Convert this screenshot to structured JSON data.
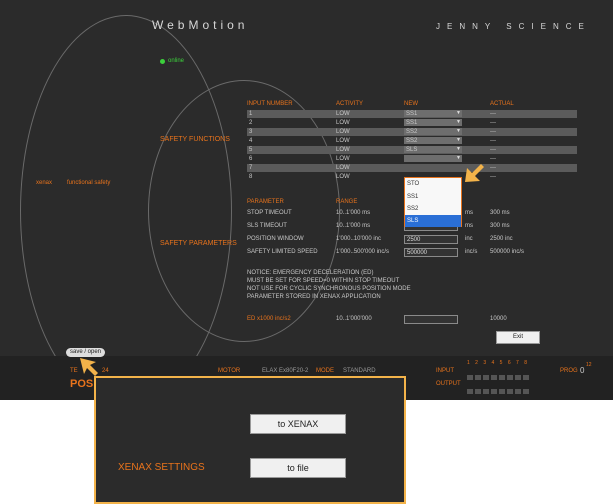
{
  "app": {
    "logo": "WebMotion",
    "brand": "JENNY SCIENCE",
    "status": "online",
    "nav_primary": "xenax",
    "nav_secondary": "functional safety"
  },
  "safety_functions": {
    "title": "SAFETY FUNCTIONS",
    "headers": [
      "INPUT NUMBER",
      "ACTIVITY",
      "NEW",
      "ACTUAL"
    ],
    "rows": [
      {
        "num": "1",
        "activity": "LOW",
        "new": "SS1",
        "actual": "---"
      },
      {
        "num": "2",
        "activity": "LOW",
        "new": "SS1",
        "actual": "---"
      },
      {
        "num": "3",
        "activity": "LOW",
        "new": "SS2",
        "actual": "---"
      },
      {
        "num": "4",
        "activity": "LOW",
        "new": "SS2",
        "actual": "---"
      },
      {
        "num": "5",
        "activity": "LOW",
        "new": "SLS",
        "actual": "---"
      },
      {
        "num": "6",
        "activity": "LOW",
        "new": "",
        "actual": "---"
      },
      {
        "num": "7",
        "activity": "LOW",
        "new": "",
        "actual": "---"
      },
      {
        "num": "8",
        "activity": "LOW",
        "new": "",
        "actual": "---"
      }
    ],
    "dropdown_options": [
      "STO",
      "SS1",
      "SS2",
      "SLS"
    ],
    "dropdown_selected": "SLS"
  },
  "safety_parameters": {
    "title": "SAFETY PARAMETERS",
    "headers": [
      "PARAMETER",
      "RANGE"
    ],
    "rows": [
      {
        "name": "STOP TIMEOUT",
        "range": "10..1'000 ms",
        "value": "",
        "unit": "ms",
        "actual": "300 ms"
      },
      {
        "name": "SLS TIMEOUT",
        "range": "10..1'000 ms",
        "value": "",
        "unit": "ms",
        "actual": "300 ms"
      },
      {
        "name": "POSITION WINDOW",
        "range": "1'000..10'000 inc",
        "value": "2500",
        "unit": "inc",
        "actual": "2500 inc"
      },
      {
        "name": "SAFETY LIMITED SPEED",
        "range": "1'000..500'000 inc/s",
        "value": "500000",
        "unit": "inc/s",
        "actual": "500000 inc/s"
      }
    ],
    "notice": [
      "NOTICE: EMERGENCY DECELERATION (ED)",
      "MUST BE SET FOR SPEED=0 WITHIN STOP TIMEOUT",
      "NOT USE FOR CYCLIC SYNCHRONOUS POSITION MODE",
      "PARAMETER STORED IN XENAX APPLICATION"
    ],
    "ed_label": "ED x1000 inc/s2",
    "ed_range": "10..1'000'000",
    "ed_actual": "10000",
    "exit_label": "Exit"
  },
  "bottom": {
    "save_open": "save / open",
    "te_label": "TE",
    "te_value": "24",
    "pos_label": "POS",
    "motor_label": "MOTOR",
    "motor_value": "ELAX Ex80F20-2",
    "mode_label": "MODE",
    "mode_value": "STANDARD",
    "input_label": "INPUT",
    "output_label": "OUTPUT",
    "input_numbers": "1 2 3 4 5 6 7 8",
    "prog_label": "PROG",
    "prog_value": "0",
    "prog_sup": "12"
  },
  "popup": {
    "title": "XENAX SETTINGS",
    "to_xenax": "to XENAX",
    "to_file": "to file"
  },
  "colors": {
    "accent": "#e8731c",
    "bg": "#2b2b2b",
    "highlight": "#f3b34a"
  }
}
